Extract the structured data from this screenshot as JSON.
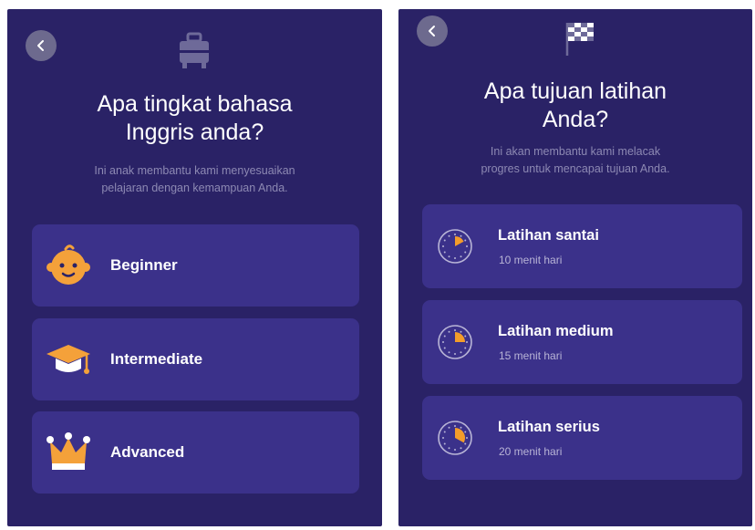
{
  "level_screen": {
    "title": "Apa tingkat bahasa\nInggris anda?",
    "subtitle": "Ini anak membantu kami menyesuaikan\npelajaran dengan kemampuan Anda.",
    "options": [
      {
        "label": "Beginner",
        "icon": "baby-face-icon"
      },
      {
        "label": "Intermediate",
        "icon": "graduation-cap-icon"
      },
      {
        "label": "Advanced",
        "icon": "crown-icon"
      }
    ],
    "header_icon": "briefcase-icon"
  },
  "goal_screen": {
    "title": "Apa tujuan latihan\nAnda?",
    "subtitle": "Ini akan membantu kami melacak\nprogres untuk mencapai tujuan Anda.",
    "options": [
      {
        "label": "Latihan santai",
        "sub": "10 menit hari",
        "fraction": 0.17
      },
      {
        "label": "Latihan medium",
        "sub": "15 menit hari",
        "fraction": 0.25
      },
      {
        "label": "Latihan serius",
        "sub": "20 menit hari",
        "fraction": 0.33
      }
    ],
    "header_icon": "checkered-flag-icon"
  },
  "colors": {
    "background": "#2a2266",
    "card": "#3b318a",
    "accent_orange": "#f39c2a",
    "muted_text": "#8d89b3"
  }
}
